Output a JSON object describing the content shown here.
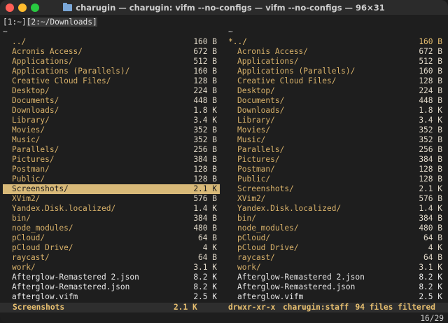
{
  "window": {
    "title": "charugin — charugin: vifm --no-configs — vifm --no-configs — 96×31"
  },
  "tabs": [
    {
      "label": "[1:~]",
      "active": false
    },
    {
      "label": "[2:~/Downloads]",
      "active": true
    }
  ],
  "left_pane": {
    "path": "~",
    "cursor_index": 15,
    "entries": [
      {
        "name": "../",
        "size": "160 B",
        "kind": "dir"
      },
      {
        "name": "Acronis Access/",
        "size": "672 B",
        "kind": "dir"
      },
      {
        "name": "Applications/",
        "size": "512 B",
        "kind": "dir"
      },
      {
        "name": "Applications (Parallels)/",
        "size": "160 B",
        "kind": "dir"
      },
      {
        "name": "Creative Cloud Files/",
        "size": "128 B",
        "kind": "dir"
      },
      {
        "name": "Desktop/",
        "size": "224 B",
        "kind": "dir"
      },
      {
        "name": "Documents/",
        "size": "448 B",
        "kind": "dir"
      },
      {
        "name": "Downloads/",
        "size": "1.8 K",
        "kind": "dir"
      },
      {
        "name": "Library/",
        "size": "3.4 K",
        "kind": "dir"
      },
      {
        "name": "Movies/",
        "size": "352 B",
        "kind": "dir"
      },
      {
        "name": "Music/",
        "size": "352 B",
        "kind": "dir"
      },
      {
        "name": "Parallels/",
        "size": "256 B",
        "kind": "dir"
      },
      {
        "name": "Pictures/",
        "size": "384 B",
        "kind": "dir"
      },
      {
        "name": "Postman/",
        "size": "128 B",
        "kind": "dir"
      },
      {
        "name": "Public/",
        "size": "128 B",
        "kind": "dir"
      },
      {
        "name": "Screenshots/",
        "size": "2.1 K",
        "kind": "dir"
      },
      {
        "name": "XVim2/",
        "size": "576 B",
        "kind": "dir"
      },
      {
        "name": "Yandex.Disk.localized/",
        "size": "1.4 K",
        "kind": "dir"
      },
      {
        "name": "bin/",
        "size": "384 B",
        "kind": "dir"
      },
      {
        "name": "node_modules/",
        "size": "480 B",
        "kind": "dir"
      },
      {
        "name": "pCloud/",
        "size": "64 B",
        "kind": "dir"
      },
      {
        "name": "pCloud Drive/",
        "size": "4 K",
        "kind": "dir"
      },
      {
        "name": "raycast/",
        "size": "64 B",
        "kind": "dir"
      },
      {
        "name": "work/",
        "size": "3.1 K",
        "kind": "dir"
      },
      {
        "name": "Afterglow-Remastered 2.json",
        "size": "8.2 K",
        "kind": "file"
      },
      {
        "name": "Afterglow-Remastered.json",
        "size": "8.2 K",
        "kind": "file"
      },
      {
        "name": "afterglow.vifm",
        "size": "2.5 K",
        "kind": "file"
      }
    ]
  },
  "right_pane": {
    "path": "~",
    "cursor_index": 0,
    "entries": [
      {
        "name": "*../",
        "size": "160 B",
        "kind": "dir"
      },
      {
        "name": "Acronis Access/",
        "size": "672 B",
        "kind": "dir"
      },
      {
        "name": "Applications/",
        "size": "512 B",
        "kind": "dir"
      },
      {
        "name": "Applications (Parallels)/",
        "size": "160 B",
        "kind": "dir"
      },
      {
        "name": "Creative Cloud Files/",
        "size": "128 B",
        "kind": "dir"
      },
      {
        "name": "Desktop/",
        "size": "224 B",
        "kind": "dir"
      },
      {
        "name": "Documents/",
        "size": "448 B",
        "kind": "dir"
      },
      {
        "name": "Downloads/",
        "size": "1.8 K",
        "kind": "dir"
      },
      {
        "name": "Library/",
        "size": "3.4 K",
        "kind": "dir"
      },
      {
        "name": "Movies/",
        "size": "352 B",
        "kind": "dir"
      },
      {
        "name": "Music/",
        "size": "352 B",
        "kind": "dir"
      },
      {
        "name": "Parallels/",
        "size": "256 B",
        "kind": "dir"
      },
      {
        "name": "Pictures/",
        "size": "384 B",
        "kind": "dir"
      },
      {
        "name": "Postman/",
        "size": "128 B",
        "kind": "dir"
      },
      {
        "name": "Public/",
        "size": "128 B",
        "kind": "dir"
      },
      {
        "name": "Screenshots/",
        "size": "2.1 K",
        "kind": "dir"
      },
      {
        "name": "XVim2/",
        "size": "576 B",
        "kind": "dir"
      },
      {
        "name": "Yandex.Disk.localized/",
        "size": "1.4 K",
        "kind": "dir"
      },
      {
        "name": "bin/",
        "size": "384 B",
        "kind": "dir"
      },
      {
        "name": "node_modules/",
        "size": "480 B",
        "kind": "dir"
      },
      {
        "name": "pCloud/",
        "size": "64 B",
        "kind": "dir"
      },
      {
        "name": "pCloud Drive/",
        "size": "4 K",
        "kind": "dir"
      },
      {
        "name": "raycast/",
        "size": "64 B",
        "kind": "dir"
      },
      {
        "name": "work/",
        "size": "3.1 K",
        "kind": "dir"
      },
      {
        "name": "Afterglow-Remastered 2.json",
        "size": "8.2 K",
        "kind": "file"
      },
      {
        "name": "Afterglow-Remastered.json",
        "size": "8.2 K",
        "kind": "file"
      },
      {
        "name": "afterglow.vifm",
        "size": "2.5 K",
        "kind": "file"
      }
    ]
  },
  "statusbar": {
    "name": "Screenshots",
    "size": "2.1 K",
    "permissions": "drwxr-xr-x",
    "owner": "charugin:staff",
    "filter": "94 files filtered"
  },
  "cmdline": {
    "position": "16/29"
  },
  "colors": {
    "accent": "#d8b978",
    "directory": "#d9b26a",
    "highlight_text": "#e8c070"
  }
}
